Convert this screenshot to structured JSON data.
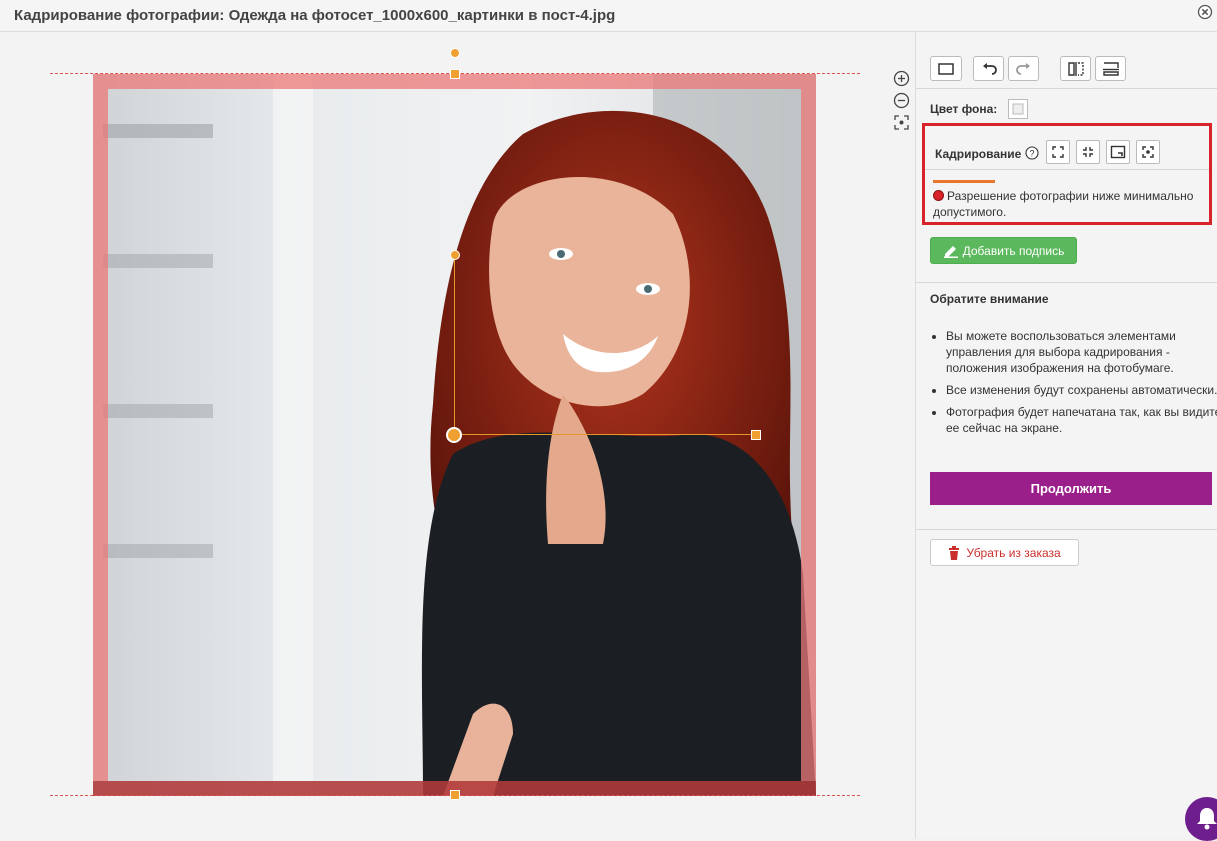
{
  "window": {
    "title": "Кадрирование фотографии: Одежда на фотосет_1000x600_картинки в пост-4.jpg"
  },
  "editor": {
    "zoom_icons": [
      "zoom-in-icon",
      "zoom-out-icon",
      "fit-screen-icon"
    ]
  },
  "sidebar": {
    "toolbar_icons": [
      "rectangle-icon",
      "undo-icon",
      "redo-icon",
      "flip-horizontal-icon",
      "flip-vertical-icon"
    ],
    "bg_label": "Цвет фона:",
    "crop": {
      "label": "Кадрирование",
      "help_icon": "question-icon",
      "buttons": [
        "expand-icon",
        "shrink-icon",
        "fit-frame-icon",
        "focus-icon"
      ],
      "warning": "Разрешение фотографии ниже минимально допустимого."
    },
    "add_caption": "Добавить подпись",
    "notice_title": "Обратите внимание",
    "notices": [
      "Вы можете воспользоваться элементами управления для выбора кадрирования - положения изображения на фотобумаге.",
      "Все изменения будут сохранены автоматически.",
      "Фотография будет напечатана так, как вы видите ее сейчас на экране."
    ],
    "continue": "Продолжить",
    "remove": "Убрать из заказа"
  },
  "colors": {
    "accent_purple": "#9b1f8b",
    "green": "#5cb85c",
    "crop_highlight": "#d8232a",
    "handle": "#f0a030"
  }
}
